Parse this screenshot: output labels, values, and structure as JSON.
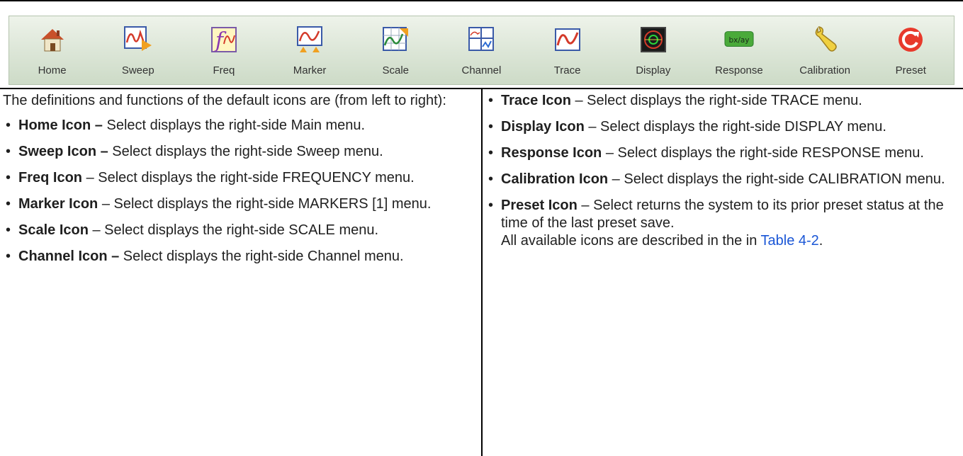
{
  "toolbar": {
    "buttons": [
      {
        "label": "Home",
        "icon": "home-icon"
      },
      {
        "label": "Sweep",
        "icon": "sweep-icon"
      },
      {
        "label": "Freq",
        "icon": "freq-icon"
      },
      {
        "label": "Marker",
        "icon": "marker-icon"
      },
      {
        "label": "Scale",
        "icon": "scale-icon"
      },
      {
        "label": "Channel",
        "icon": "channel-icon"
      },
      {
        "label": "Trace",
        "icon": "trace-icon"
      },
      {
        "label": "Display",
        "icon": "display-icon"
      },
      {
        "label": "Response",
        "icon": "response-icon",
        "icon_text": "bx/ay"
      },
      {
        "label": "Calibration",
        "icon": "calibration-icon"
      },
      {
        "label": "Preset",
        "icon": "preset-icon"
      }
    ]
  },
  "left_column": {
    "intro": "The definitions and functions of the default icons are (from left to right):",
    "items": [
      {
        "term": "Home Icon –",
        "desc": " Select displays the right-side Main menu."
      },
      {
        "term": "Sweep Icon –",
        "desc": " Select displays the right-side Sweep menu."
      },
      {
        "term": "Freq Icon",
        "desc": " – Select displays the right-side FREQUENCY menu."
      },
      {
        "term": "Marker Icon",
        "desc": " – Select displays the right-side MARKERS [1] menu."
      },
      {
        "term": "Scale Icon",
        "desc": " – Select displays the right-side SCALE menu."
      },
      {
        "term": "Channel Icon –",
        "desc": " Select displays the right-side Channel menu."
      }
    ]
  },
  "right_column": {
    "items": [
      {
        "term": "Trace Icon",
        "desc": " – Select displays the right-side TRACE menu."
      },
      {
        "term": "Display Icon",
        "desc": " – Select displays the right-side DISPLAY menu."
      },
      {
        "term": "Response Icon",
        "desc": " – Select displays the right-side RESPONSE menu."
      },
      {
        "term": "Calibration Icon",
        "desc": " – Select displays the right-side CALIBRATION menu."
      },
      {
        "term": "Preset Icon",
        "desc": " – Select returns the system to its prior preset status at the time of the last preset save."
      }
    ],
    "note_text": "All available icons are described in the in ",
    "note_link": "Table 4-2",
    "note_end": "."
  },
  "bullet": "•",
  "colors": {
    "link": "#1a56d6",
    "toolbar_bg": "#dbe5d6",
    "preset_red": "#e8392b"
  }
}
